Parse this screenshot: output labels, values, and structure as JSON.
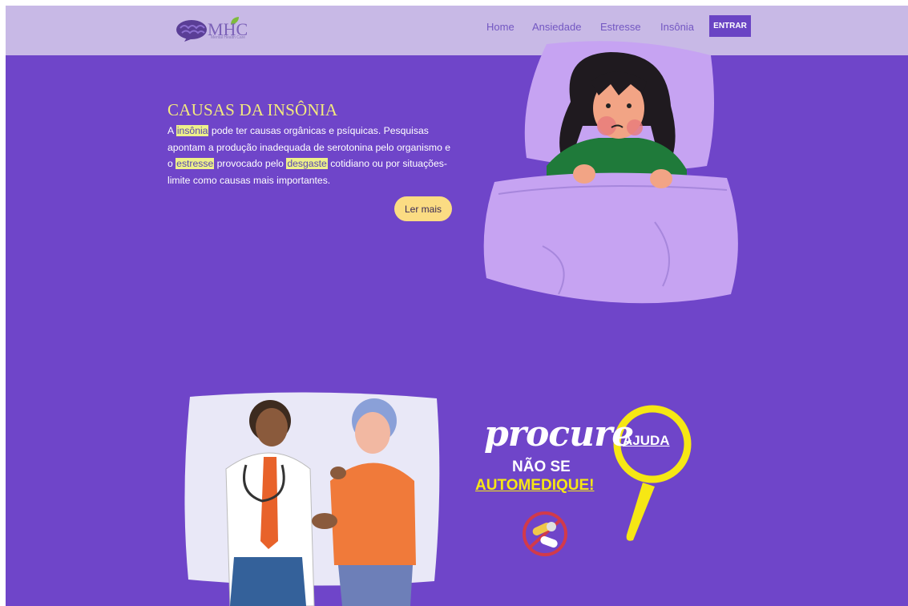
{
  "header": {
    "logo_text": "MHC",
    "logo_sub": "Mental Health Care",
    "nav": {
      "home": "Home",
      "ansiedade": "Ansiedade",
      "estresse": "Estresse",
      "insonia": "Insônia"
    },
    "entrar_label": "ENTRAR"
  },
  "hero": {
    "title": "CAUSAS DA INSÔNIA",
    "text": {
      "p1": "A ",
      "h1": "insônia",
      "p2": " pode ter causas orgânicas e psíquicas. Pesquisas apontam a produção inadequada de serotonina pelo organismo e o ",
      "h2": "estresse",
      "p3": " provocado pelo ",
      "h3": "desgaste",
      "p4": " cotidiano ou por situações-limite como causas mais importantes."
    },
    "read_more_label": "Ler mais"
  },
  "banner": {
    "procure": "procure",
    "ajuda": "AJUDA",
    "nao_se": "NÃO SE",
    "automedique": "AUTOMEDIQUE!"
  },
  "colors": {
    "background": "#6f45c9",
    "header_bg": "#c8b9e6",
    "title_yellow": "#f3ea7d",
    "highlight": "#eef08a",
    "button_yellow": "#fbdc83",
    "magnifier_yellow": "#f6e714"
  },
  "icons": {
    "logo": "brain-logo-icon",
    "no_pills": "no-pills-icon",
    "magnifier": "magnifying-glass-icon"
  }
}
